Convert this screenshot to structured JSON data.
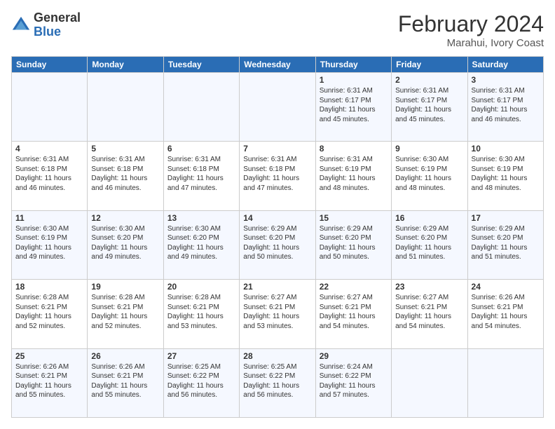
{
  "logo": {
    "general": "General",
    "blue": "Blue"
  },
  "header": {
    "title": "February 2024",
    "subtitle": "Marahui, Ivory Coast"
  },
  "weekdays": [
    "Sunday",
    "Monday",
    "Tuesday",
    "Wednesday",
    "Thursday",
    "Friday",
    "Saturday"
  ],
  "weeks": [
    [
      {
        "day": "",
        "info": ""
      },
      {
        "day": "",
        "info": ""
      },
      {
        "day": "",
        "info": ""
      },
      {
        "day": "",
        "info": ""
      },
      {
        "day": "1",
        "info": "Sunrise: 6:31 AM\nSunset: 6:17 PM\nDaylight: 11 hours\nand 45 minutes."
      },
      {
        "day": "2",
        "info": "Sunrise: 6:31 AM\nSunset: 6:17 PM\nDaylight: 11 hours\nand 45 minutes."
      },
      {
        "day": "3",
        "info": "Sunrise: 6:31 AM\nSunset: 6:17 PM\nDaylight: 11 hours\nand 46 minutes."
      }
    ],
    [
      {
        "day": "4",
        "info": "Sunrise: 6:31 AM\nSunset: 6:18 PM\nDaylight: 11 hours\nand 46 minutes."
      },
      {
        "day": "5",
        "info": "Sunrise: 6:31 AM\nSunset: 6:18 PM\nDaylight: 11 hours\nand 46 minutes."
      },
      {
        "day": "6",
        "info": "Sunrise: 6:31 AM\nSunset: 6:18 PM\nDaylight: 11 hours\nand 47 minutes."
      },
      {
        "day": "7",
        "info": "Sunrise: 6:31 AM\nSunset: 6:18 PM\nDaylight: 11 hours\nand 47 minutes."
      },
      {
        "day": "8",
        "info": "Sunrise: 6:31 AM\nSunset: 6:19 PM\nDaylight: 11 hours\nand 48 minutes."
      },
      {
        "day": "9",
        "info": "Sunrise: 6:30 AM\nSunset: 6:19 PM\nDaylight: 11 hours\nand 48 minutes."
      },
      {
        "day": "10",
        "info": "Sunrise: 6:30 AM\nSunset: 6:19 PM\nDaylight: 11 hours\nand 48 minutes."
      }
    ],
    [
      {
        "day": "11",
        "info": "Sunrise: 6:30 AM\nSunset: 6:19 PM\nDaylight: 11 hours\nand 49 minutes."
      },
      {
        "day": "12",
        "info": "Sunrise: 6:30 AM\nSunset: 6:20 PM\nDaylight: 11 hours\nand 49 minutes."
      },
      {
        "day": "13",
        "info": "Sunrise: 6:30 AM\nSunset: 6:20 PM\nDaylight: 11 hours\nand 49 minutes."
      },
      {
        "day": "14",
        "info": "Sunrise: 6:29 AM\nSunset: 6:20 PM\nDaylight: 11 hours\nand 50 minutes."
      },
      {
        "day": "15",
        "info": "Sunrise: 6:29 AM\nSunset: 6:20 PM\nDaylight: 11 hours\nand 50 minutes."
      },
      {
        "day": "16",
        "info": "Sunrise: 6:29 AM\nSunset: 6:20 PM\nDaylight: 11 hours\nand 51 minutes."
      },
      {
        "day": "17",
        "info": "Sunrise: 6:29 AM\nSunset: 6:20 PM\nDaylight: 11 hours\nand 51 minutes."
      }
    ],
    [
      {
        "day": "18",
        "info": "Sunrise: 6:28 AM\nSunset: 6:21 PM\nDaylight: 11 hours\nand 52 minutes."
      },
      {
        "day": "19",
        "info": "Sunrise: 6:28 AM\nSunset: 6:21 PM\nDaylight: 11 hours\nand 52 minutes."
      },
      {
        "day": "20",
        "info": "Sunrise: 6:28 AM\nSunset: 6:21 PM\nDaylight: 11 hours\nand 53 minutes."
      },
      {
        "day": "21",
        "info": "Sunrise: 6:27 AM\nSunset: 6:21 PM\nDaylight: 11 hours\nand 53 minutes."
      },
      {
        "day": "22",
        "info": "Sunrise: 6:27 AM\nSunset: 6:21 PM\nDaylight: 11 hours\nand 54 minutes."
      },
      {
        "day": "23",
        "info": "Sunrise: 6:27 AM\nSunset: 6:21 PM\nDaylight: 11 hours\nand 54 minutes."
      },
      {
        "day": "24",
        "info": "Sunrise: 6:26 AM\nSunset: 6:21 PM\nDaylight: 11 hours\nand 54 minutes."
      }
    ],
    [
      {
        "day": "25",
        "info": "Sunrise: 6:26 AM\nSunset: 6:21 PM\nDaylight: 11 hours\nand 55 minutes."
      },
      {
        "day": "26",
        "info": "Sunrise: 6:26 AM\nSunset: 6:21 PM\nDaylight: 11 hours\nand 55 minutes."
      },
      {
        "day": "27",
        "info": "Sunrise: 6:25 AM\nSunset: 6:22 PM\nDaylight: 11 hours\nand 56 minutes."
      },
      {
        "day": "28",
        "info": "Sunrise: 6:25 AM\nSunset: 6:22 PM\nDaylight: 11 hours\nand 56 minutes."
      },
      {
        "day": "29",
        "info": "Sunrise: 6:24 AM\nSunset: 6:22 PM\nDaylight: 11 hours\nand 57 minutes."
      },
      {
        "day": "",
        "info": ""
      },
      {
        "day": "",
        "info": ""
      }
    ]
  ]
}
